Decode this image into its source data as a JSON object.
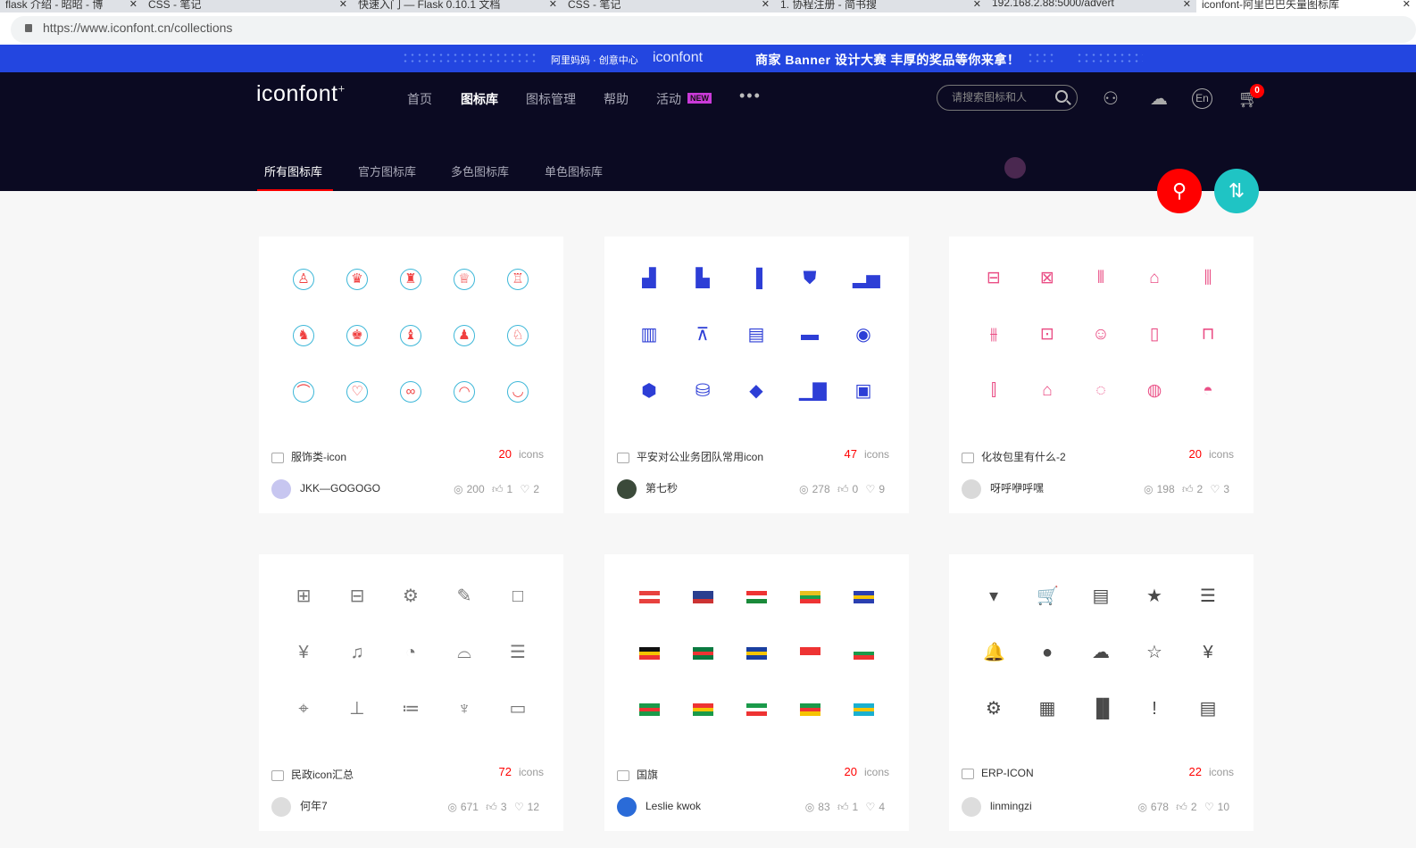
{
  "browser": {
    "tabs": [
      "flask 介绍 - 昭昭 - 博",
      "CSS - 笔记",
      "快速入门 — Flask 0.10.1 文档",
      "CSS - 笔记",
      "1. 协程注册 - 简书搜",
      "192.168.2.88:5000/advert",
      "iconfont-阿里巴巴矢量图标库"
    ],
    "url": "https://www.iconfont.cn/collections"
  },
  "banner": {
    "org": "阿里妈妈 · 创意中心",
    "logo": "iconfont",
    "text": "商家 Banner 设计大赛   丰厚的奖品等你来拿！"
  },
  "nav": {
    "brand": "iconfont",
    "items": [
      "首页",
      "图标库",
      "图标管理",
      "帮助",
      "活动"
    ],
    "new_badge": "NEW",
    "more": "•••",
    "search_placeholder": "请搜索图标和人",
    "lang": "En",
    "cart_count": "0"
  },
  "subnav": [
    "所有图标库",
    "官方图标库",
    "多色图标库",
    "单色图标库"
  ],
  "cards": [
    {
      "name": "服饰类-icon",
      "count": "20",
      "unit": "icons",
      "author": "JKK—GOGOGO",
      "views": "200",
      "likes": "1",
      "favs": "2",
      "avatar": "#c7c6f0",
      "style": "c1",
      "glyphs": [
        "♙",
        "♛",
        "♜",
        "♕",
        "♖",
        "♞",
        "♚",
        "♝",
        "♟",
        "♘",
        "⌒",
        "♡",
        "∞",
        "◠",
        "◡"
      ]
    },
    {
      "name": "平安对公业务团队常用icon",
      "count": "47",
      "unit": "icons",
      "author": "第七秒",
      "views": "278",
      "likes": "0",
      "favs": "9",
      "avatar": "#3b4a3a",
      "style": "c2",
      "glyphs": [
        "▟",
        "▙",
        "▐",
        "⛊",
        "▂▅",
        "▥",
        "⊼",
        "▤",
        "▬",
        "◉",
        "⬢",
        "⛁",
        "◆",
        "▁▇",
        "▣"
      ]
    },
    {
      "name": "化妆包里有什么-2",
      "count": "20",
      "unit": "icons",
      "author": "呀呼咿呼嘿",
      "views": "198",
      "likes": "2",
      "favs": "3",
      "avatar": "#d9d9d9",
      "style": "c3",
      "glyphs": [
        "⊟",
        "⊠",
        "⫴",
        "⌂",
        "⫼",
        "⫵",
        "⊡",
        "☺",
        "▯",
        "⊓",
        "⫿",
        "⌂",
        "◌",
        "◍",
        "◓"
      ]
    },
    {
      "name": "民政icon汇总",
      "count": "72",
      "unit": "icons",
      "author": "何年7",
      "views": "671",
      "likes": "3",
      "favs": "12",
      "avatar": "#ddd",
      "style": "c4",
      "glyphs": [
        "⊞",
        "⊟",
        "⚙",
        "✎",
        "□",
        "¥",
        "♫",
        "◔",
        "⌓",
        "☰",
        "⌖",
        "⊥",
        "≔",
        "♆",
        "▭"
      ]
    },
    {
      "name": "国旗",
      "count": "20",
      "unit": "icons",
      "author": "Leslie kwok",
      "views": "83",
      "likes": "1",
      "favs": "4",
      "avatar": "#2a6bd8",
      "style": "c5",
      "flags": [
        [
          "#e8413e",
          "#fff",
          "#e8413e"
        ],
        [
          "#2a3f8f",
          "#2a3f8f",
          "#c33"
        ],
        [
          "#e33",
          "#fff",
          "#1a8a3a"
        ],
        [
          "#e8c120",
          "#1aa04a",
          "#e33"
        ],
        [
          "#2a3fb0",
          "#f6c400",
          "#2a3fb0"
        ],
        [
          "#111",
          "#f6c400",
          "#e33"
        ],
        [
          "#0a7a40",
          "#e33",
          "#0a7a40"
        ],
        [
          "#1a3fa0",
          "#f6c400",
          "#1a3fa0"
        ],
        [
          "#e33",
          "#e33",
          "#fff"
        ],
        [
          "#fff",
          "#1a9a4a",
          "#e33"
        ],
        [
          "#1a9a4a",
          "#e33",
          "#1a9a4a"
        ],
        [
          "#e33",
          "#f6c400",
          "#1a9a4a"
        ],
        [
          "#1a9a4a",
          "#fff",
          "#e33"
        ],
        [
          "#1a9a4a",
          "#e33",
          "#f6c400"
        ],
        [
          "#1ab0d0",
          "#f6c400",
          "#1ab0d0"
        ]
      ]
    },
    {
      "name": "ERP-ICON",
      "count": "22",
      "unit": "icons",
      "author": "linmingzi",
      "views": "678",
      "likes": "2",
      "favs": "10",
      "avatar": "#ddd",
      "style": "c6",
      "glyphs": [
        "▾",
        "🛒",
        "▤",
        "★",
        "☰",
        "🔔",
        "●",
        "☁",
        "☆",
        "¥",
        "⚙",
        "▦",
        "▐▌",
        "!",
        "▤"
      ]
    }
  ],
  "colors": {
    "accent": "#ff0000",
    "nav_bg": "#0b0a22",
    "banner_bg": "#2346e0",
    "teal": "#1fc4c4"
  }
}
